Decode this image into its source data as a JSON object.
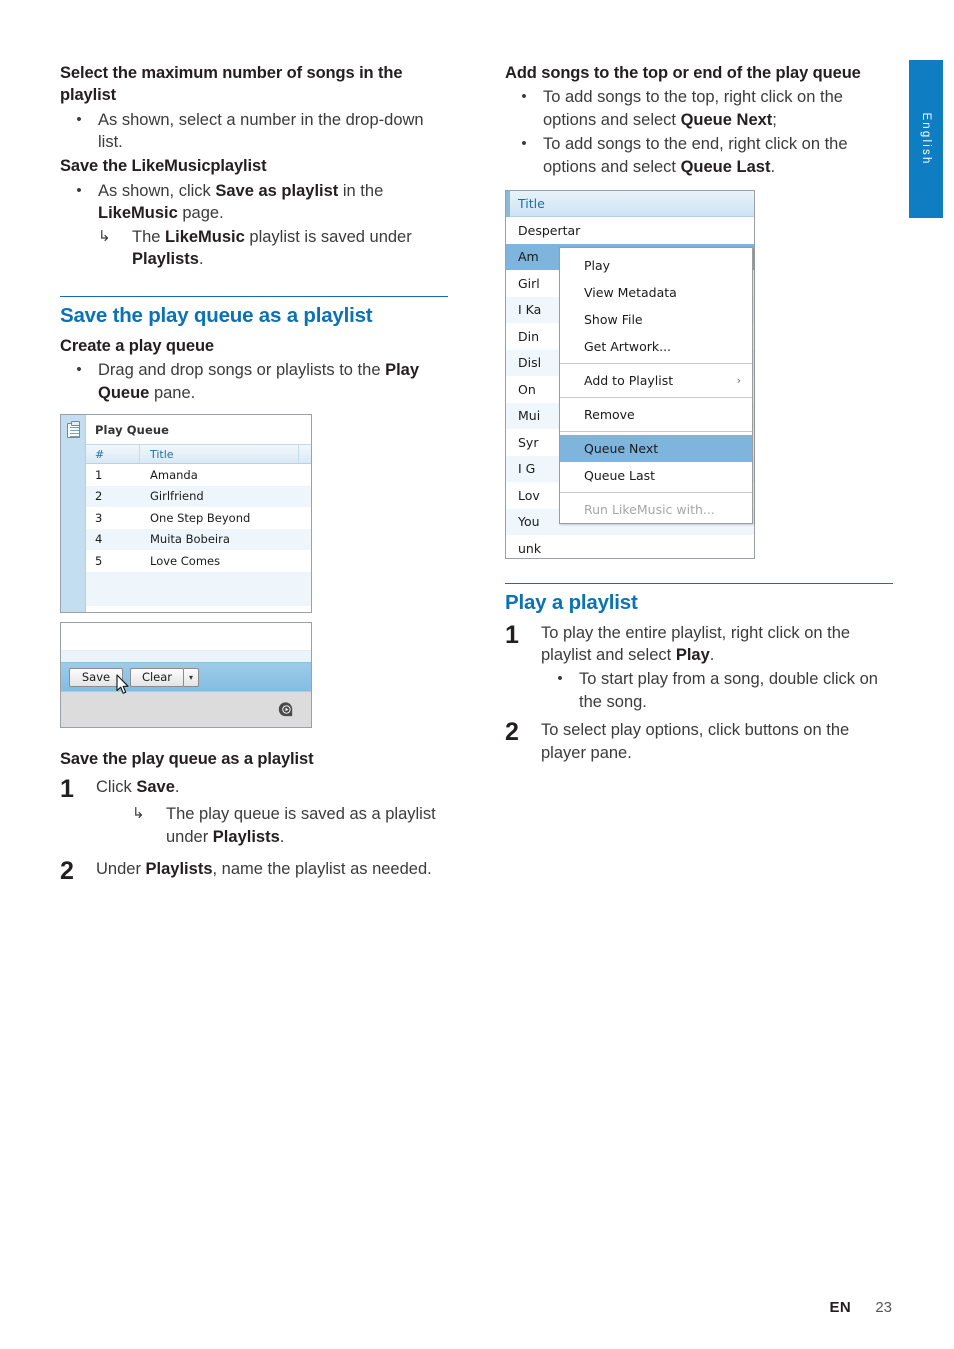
{
  "page": {
    "language_tab": "English",
    "footer_lang": "EN",
    "footer_page": "23",
    "accent_color": "#0b72b5"
  },
  "left_column": {
    "block1": {
      "heading": "Select the maximum number of songs in the playlist",
      "bullets": [
        {
          "bullet": "•",
          "text_before": "As shown, select a number in the drop-down list."
        }
      ]
    },
    "block2": {
      "heading": "Save the LikeMusicplaylist",
      "bullet_marker": "•",
      "bullet_pre": "As shown, click ",
      "bullet_bold1": "Save as playlist",
      "bullet_mid": " in the ",
      "bullet_bold2": "LikeMusic",
      "bullet_post": " page.",
      "arrow_marker": "↳",
      "arrow_pre": "The ",
      "arrow_bold1": "LikeMusic",
      "arrow_mid": " playlist is saved under ",
      "arrow_bold2": "Playlists",
      "arrow_post": "."
    },
    "section_heading": "Save the play queue as a playlist",
    "create_queue": {
      "heading": "Create a play queue",
      "bullet_marker": "•",
      "text_pre": "Drag and drop songs or playlists to the ",
      "text_bold": "Play Queue",
      "text_post": " pane."
    },
    "save_queue": {
      "heading": "Save the play queue as a playlist",
      "step1_number": "1",
      "step1_pre": "Click ",
      "step1_bold": "Save",
      "step1_post": ".",
      "step1_arrow_marker": "↳",
      "step1_arrow_pre": "The play queue is saved as a playlist under ",
      "step1_arrow_bold": "Playlists",
      "step1_arrow_post": ".",
      "step2_number": "2",
      "step2_pre": "Under ",
      "step2_bold": "Playlists",
      "step2_post": ", name the playlist as needed."
    }
  },
  "right_column": {
    "block1": {
      "heading": "Add songs to the top or end of the play queue",
      "bullet1_marker": "•",
      "bullet1_pre": "To add songs to the top, right click on the options and select ",
      "bullet1_bold": "Queue Next",
      "bullet1_post": ";",
      "bullet2_marker": "•",
      "bullet2_pre": "To add songs to the end, right click on the options and select ",
      "bullet2_bold": "Queue Last",
      "bullet2_post": "."
    },
    "section_heading": "Play a playlist",
    "play_playlist": {
      "step1_number": "1",
      "step1_pre": "To play the entire playlist, right click on the playlist and select ",
      "step1_bold": "Play",
      "step1_post": ".",
      "step1_bullet_marker": "•",
      "step1_bullet_text": "To start play from a song, double click on the song.",
      "step2_number": "2",
      "step2_text": "To select play options, click buttons on the player pane."
    }
  },
  "figure_play_queue": {
    "icon": "clipboard-list-icon",
    "title": "Play Queue",
    "columns": {
      "number": "#",
      "title": "Title"
    },
    "rows": [
      {
        "num": "1",
        "title": "Amanda"
      },
      {
        "num": "2",
        "title": "Girlfriend"
      },
      {
        "num": "3",
        "title": "One Step Beyond"
      },
      {
        "num": "4",
        "title": "Muita Bobeira"
      },
      {
        "num": "5",
        "title": "Love Comes"
      }
    ]
  },
  "figure_toolbar": {
    "save_label": "Save",
    "clear_label": "Clear",
    "dropdown_glyph": "▾",
    "logo": "philips-logo",
    "cursor": "mouse-pointer"
  },
  "figure_context_menu": {
    "header_title": "Title",
    "list_rows": [
      {
        "title": "Despertar",
        "selected": false
      },
      {
        "title": "Am",
        "selected": true
      },
      {
        "title": "Girl",
        "selected": false
      },
      {
        "title": "I Ka",
        "selected": false
      },
      {
        "title": "Din",
        "selected": false
      },
      {
        "title": "Disl",
        "selected": false
      },
      {
        "title": "On",
        "selected": false
      },
      {
        "title": "Mui",
        "selected": false
      },
      {
        "title": "Syr",
        "selected": false
      },
      {
        "title": "I G",
        "selected": false
      },
      {
        "title": "Lov",
        "selected": false
      },
      {
        "title": "You",
        "selected": false
      },
      {
        "title": "unk",
        "selected": false
      }
    ],
    "menu_items": [
      {
        "label": "Play",
        "state": "normal",
        "submenu": false
      },
      {
        "label": "View Metadata",
        "state": "normal",
        "submenu": false
      },
      {
        "label": "Show File",
        "state": "normal",
        "submenu": false
      },
      {
        "label": "Get Artwork...",
        "state": "normal",
        "submenu": false
      },
      {
        "label": "Add to Playlist",
        "state": "normal",
        "submenu": true,
        "submenu_glyph": "›"
      },
      {
        "label": "Remove",
        "state": "normal",
        "submenu": false
      },
      {
        "label": "Queue Next",
        "state": "highlighted",
        "submenu": false
      },
      {
        "label": "Queue Last",
        "state": "normal",
        "submenu": false
      },
      {
        "label": "Run LikeMusic with...",
        "state": "disabled",
        "submenu": false
      }
    ],
    "cursor": "mouse-pointer"
  }
}
